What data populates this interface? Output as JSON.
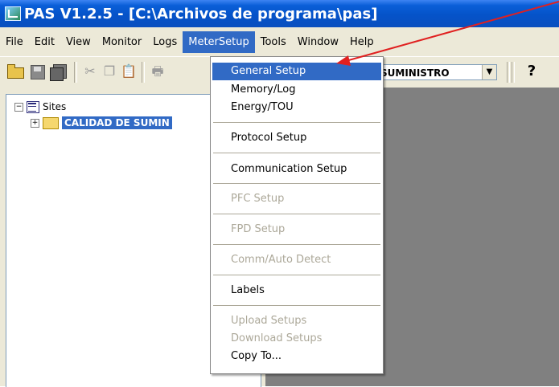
{
  "window": {
    "title": "PAS V1.2.5 - [C:\\Archivos de programa\\pas]"
  },
  "menubar": {
    "items": [
      "File",
      "Edit",
      "View",
      "Monitor",
      "Logs",
      "MeterSetup",
      "Tools",
      "Window",
      "Help"
    ],
    "active": "MeterSetup"
  },
  "toolbar": {
    "site_select_value": "SUMINISTRO",
    "help_glyph": "?"
  },
  "tree": {
    "root_label": "Sites",
    "root_expander": "−",
    "child_label": "CALIDAD DE SUMIN",
    "child_expander": "+"
  },
  "dropdown": {
    "items": [
      {
        "label": "General Setup",
        "state": "highlighted"
      },
      {
        "label": "Memory/Log",
        "state": "enabled"
      },
      {
        "label": "Energy/TOU",
        "state": "enabled"
      },
      {
        "label": "Protocol Setup",
        "state": "enabled"
      },
      {
        "label": "Communication Setup",
        "state": "enabled"
      },
      {
        "label": "PFC Setup",
        "state": "disabled"
      },
      {
        "label": "FPD Setup",
        "state": "disabled"
      },
      {
        "label": "Comm/Auto Detect",
        "state": "disabled"
      },
      {
        "label": "Labels",
        "state": "enabled"
      },
      {
        "label": "Upload Setups",
        "state": "disabled"
      },
      {
        "label": "Download Setups",
        "state": "disabled"
      },
      {
        "label": "Copy To...",
        "state": "enabled"
      }
    ]
  },
  "colors": {
    "titlebar": "#0553c9",
    "selection": "#316ac5",
    "annotation_arrow": "#e02020",
    "workspace": "#808080"
  }
}
